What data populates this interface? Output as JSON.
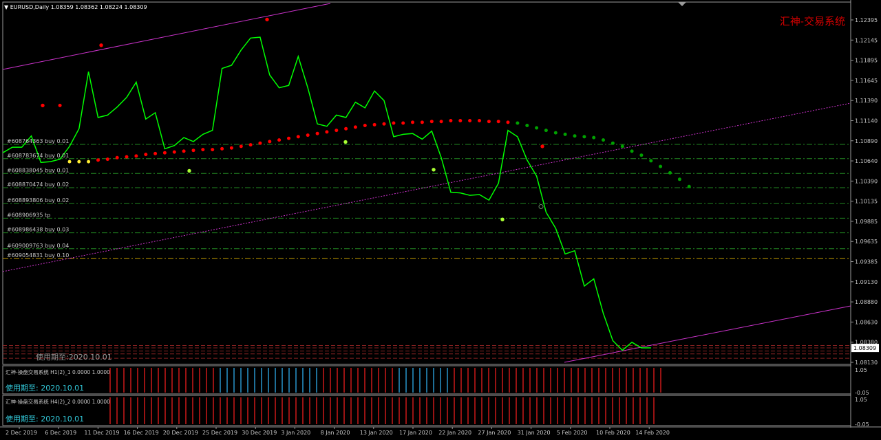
{
  "header": {
    "symbol_info": "EURUSD,Daily  1.08359 1.08362 1.08224 1.08309",
    "watermark": "汇神-交易系统"
  },
  "price_axis": {
    "ticks": [
      "1.12395",
      "1.12145",
      "1.11895",
      "1.11645",
      "1.11390",
      "1.11140",
      "1.10890",
      "1.10640",
      "1.10390",
      "1.10135",
      "1.09885",
      "1.09635",
      "1.09385",
      "1.09130",
      "1.08880",
      "1.08630",
      "1.08380",
      "1.08130"
    ],
    "current_price": "1.08309"
  },
  "time_axis": {
    "labels": [
      "2 Dec 2019",
      "6 Dec 2019",
      "11 Dec 2019",
      "16 Dec 2019",
      "20 Dec 2019",
      "25 Dec 2019",
      "30 Dec 2019",
      "3 Jan 2020",
      "8 Jan 2020",
      "13 Jan 2020",
      "17 Jan 2020",
      "22 Jan 2020",
      "27 Jan 2020",
      "31 Jan 2020",
      "5 Feb 2020",
      "10 Feb 2020",
      "14 Feb 2020"
    ]
  },
  "orders": [
    {
      "label": "#608764363 buy 0.01"
    },
    {
      "label": "#608783674 buy 0.01"
    },
    {
      "label": "#608838045 buy 0.01"
    },
    {
      "label": "#608870474 buy 0.02"
    },
    {
      "label": "#608893806 buy 0.02"
    },
    {
      "label": "#608906935 tp"
    },
    {
      "label": "#608986438 buy 0.03"
    },
    {
      "label": "#609009763 buy 0.04"
    },
    {
      "label": "#609054831 buy 0.10"
    }
  ],
  "overlay_license": "使用期至:2020.10.01",
  "indicators": [
    {
      "title": "汇神-操盘交易系统 H1(2)_1 0.0000 1.0000",
      "license": "使用期至: 2020.10.01",
      "scale_top": "1.05",
      "scale_bottom": "-0.05"
    },
    {
      "title": "汇神-操盘交易系统 H4(2)_2 0.0000 1.0000",
      "license": "使用期至: 2020.10.01",
      "scale_top": "1.05",
      "scale_bottom": "-0.05"
    }
  ],
  "colors": {
    "price_line": "#00ff00",
    "sar_bear": "#ff0000",
    "sar_bull": "#00a000",
    "channel": "#cc33cc",
    "order_line": "#228822",
    "tp_line": "#c8a000",
    "ind_red": "#ff2020",
    "ind_blue": "#33bbff"
  },
  "chart_data": {
    "type": "line",
    "symbol": "EURUSD",
    "timeframe": "Daily",
    "series": [
      {
        "name": "EURUSD",
        "values": [
          1.1074,
          1.1081,
          1.1081,
          1.1095,
          1.1062,
          1.1063,
          1.1066,
          1.1082,
          1.1104,
          1.1175,
          1.1118,
          1.1121,
          1.1131,
          1.1143,
          1.1162,
          1.1116,
          1.1124,
          1.1079,
          1.1083,
          1.1093,
          1.1088,
          1.1097,
          1.1102,
          1.1179,
          1.1183,
          1.1202,
          1.1217,
          1.1218,
          1.1171,
          1.1155,
          1.1158,
          1.1194,
          1.1155,
          1.111,
          1.1107,
          1.1121,
          1.1118,
          1.1137,
          1.113,
          1.1151,
          1.1139,
          1.1094,
          1.1097,
          1.1098,
          1.1091,
          1.1101,
          1.1068,
          1.1025,
          1.1024,
          1.1021,
          1.1022,
          1.1015,
          1.1036,
          1.1102,
          1.1094,
          1.1065,
          1.1045,
          1.1,
          1.098,
          1.0948,
          1.0952,
          1.0908,
          1.0917,
          1.0874,
          1.084,
          1.0828,
          1.0838,
          1.0831,
          1.0831
        ]
      }
    ],
    "sar_points": [
      {
        "v": 1.1133,
        "c": "red"
      },
      {
        "v": 1.1063,
        "c": "yellow"
      },
      {
        "v": 1.1063,
        "c": "yellow"
      },
      {
        "v": 1.1063,
        "c": "yellow"
      },
      {
        "v": 1.1065,
        "c": "red"
      },
      {
        "v": 1.1066,
        "c": "red"
      },
      {
        "v": 1.1068,
        "c": "red"
      },
      {
        "v": 1.1069,
        "c": "red"
      },
      {
        "v": 1.107,
        "c": "red"
      },
      {
        "v": 1.1072,
        "c": "red"
      },
      {
        "v": 1.1073,
        "c": "red"
      },
      {
        "v": 1.1074,
        "c": "red"
      },
      {
        "v": 1.1075,
        "c": "red"
      },
      {
        "v": 1.1076,
        "c": "red"
      },
      {
        "v": 1.1077,
        "c": "red"
      },
      {
        "v": 1.1078,
        "c": "red"
      },
      {
        "v": 1.1078,
        "c": "red"
      },
      {
        "v": 1.1079,
        "c": "red"
      },
      {
        "v": 1.108,
        "c": "red"
      },
      {
        "v": 1.1082,
        "c": "red"
      },
      {
        "v": 1.1084,
        "c": "red"
      },
      {
        "v": 1.1086,
        "c": "red"
      },
      {
        "v": 1.1088,
        "c": "red"
      },
      {
        "v": 1.109,
        "c": "red"
      },
      {
        "v": 1.1092,
        "c": "red"
      },
      {
        "v": 1.1094,
        "c": "red"
      },
      {
        "v": 1.1096,
        "c": "red"
      },
      {
        "v": 1.1098,
        "c": "red"
      },
      {
        "v": 1.11,
        "c": "red"
      },
      {
        "v": 1.1102,
        "c": "red"
      },
      {
        "v": 1.1104,
        "c": "red"
      },
      {
        "v": 1.1106,
        "c": "red"
      },
      {
        "v": 1.1108,
        "c": "red"
      },
      {
        "v": 1.1109,
        "c": "red"
      },
      {
        "v": 1.111,
        "c": "red"
      },
      {
        "v": 1.1111,
        "c": "red"
      },
      {
        "v": 1.1111,
        "c": "red"
      },
      {
        "v": 1.1112,
        "c": "red"
      },
      {
        "v": 1.1112,
        "c": "red"
      },
      {
        "v": 1.1113,
        "c": "red"
      },
      {
        "v": 1.1113,
        "c": "red"
      },
      {
        "v": 1.1114,
        "c": "red"
      },
      {
        "v": 1.1114,
        "c": "red"
      },
      {
        "v": 1.1114,
        "c": "red"
      },
      {
        "v": 1.1114,
        "c": "red"
      },
      {
        "v": 1.1113,
        "c": "red"
      },
      {
        "v": 1.1113,
        "c": "red"
      },
      {
        "v": 1.1112,
        "c": "red"
      },
      {
        "v": 1.1111,
        "c": "green"
      },
      {
        "v": 1.1108,
        "c": "green"
      },
      {
        "v": 1.1105,
        "c": "green"
      },
      {
        "v": 1.1102,
        "c": "green"
      },
      {
        "v": 1.1099,
        "c": "green"
      },
      {
        "v": 1.1097,
        "c": "green"
      },
      {
        "v": 1.1095,
        "c": "green"
      },
      {
        "v": 1.1094,
        "c": "green"
      },
      {
        "v": 1.1093,
        "c": "green"
      },
      {
        "v": 1.109,
        "c": "green"
      },
      {
        "v": 1.1086,
        "c": "green"
      },
      {
        "v": 1.1082,
        "c": "green"
      },
      {
        "v": 1.1076,
        "c": "green"
      },
      {
        "v": 1.1071,
        "c": "green"
      },
      {
        "v": 1.1064,
        "c": "green"
      },
      {
        "v": 1.1057,
        "c": "green"
      },
      {
        "v": 1.1049,
        "c": "green"
      },
      {
        "v": 1.1041,
        "c": "green"
      },
      {
        "v": 1.1032,
        "c": "green"
      }
    ],
    "order_levels": [
      1.10845,
      1.10667,
      1.10483,
      1.10305,
      1.1011,
      1.09925,
      1.09743,
      1.09545,
      1.09424
    ],
    "indicator_pattern": [
      [
        "red",
        "red",
        "red",
        "red",
        "red",
        "red",
        "red",
        "red",
        "red",
        "red",
        "red",
        "red",
        "red",
        "red",
        "red",
        "red",
        "blue",
        "blue",
        "blue",
        "blue",
        "blue",
        "blue",
        "blue",
        "blue",
        "blue",
        "blue",
        "blue",
        "blue",
        "blue",
        "blue",
        "blue",
        "red",
        "red",
        "red",
        "red",
        "red",
        "red",
        "red",
        "red",
        "red",
        "red",
        "red",
        "blue",
        "blue",
        "blue",
        "blue",
        "blue",
        "blue",
        "blue",
        "blue",
        "red",
        "red",
        "red",
        "red",
        "red",
        "red",
        "red",
        "red",
        "red",
        "red",
        "red",
        "red",
        "red",
        "red",
        "red",
        "red",
        "red",
        "red",
        "red",
        "red",
        "red",
        "red",
        "red",
        "red",
        "red",
        "red",
        "red",
        "red",
        "red",
        "red",
        "red",
        "red"
      ],
      [
        "red",
        "red",
        "red",
        "red",
        "red",
        "red",
        "red",
        "red",
        "red",
        "red",
        "red",
        "red",
        "red",
        "red",
        "red",
        "red",
        "red",
        "red",
        "red",
        "red",
        "red",
        "red",
        "red",
        "red",
        "red",
        "red",
        "red",
        "red",
        "red",
        "red",
        "red",
        "red",
        "red",
        "red",
        "red",
        "red",
        "red",
        "red",
        "red",
        "red",
        "red",
        "red",
        "red",
        "red",
        "red",
        "red",
        "red",
        "red",
        "red",
        "red",
        "red",
        "red",
        "red",
        "red",
        "red",
        "red",
        "red",
        "red",
        "red",
        "red",
        "red",
        "red",
        "red",
        "red",
        "red",
        "red",
        "red",
        "red",
        "red",
        "red",
        "red",
        "red",
        "red",
        "red",
        "red",
        "red",
        "red",
        "red",
        "red",
        "red"
      ]
    ]
  }
}
